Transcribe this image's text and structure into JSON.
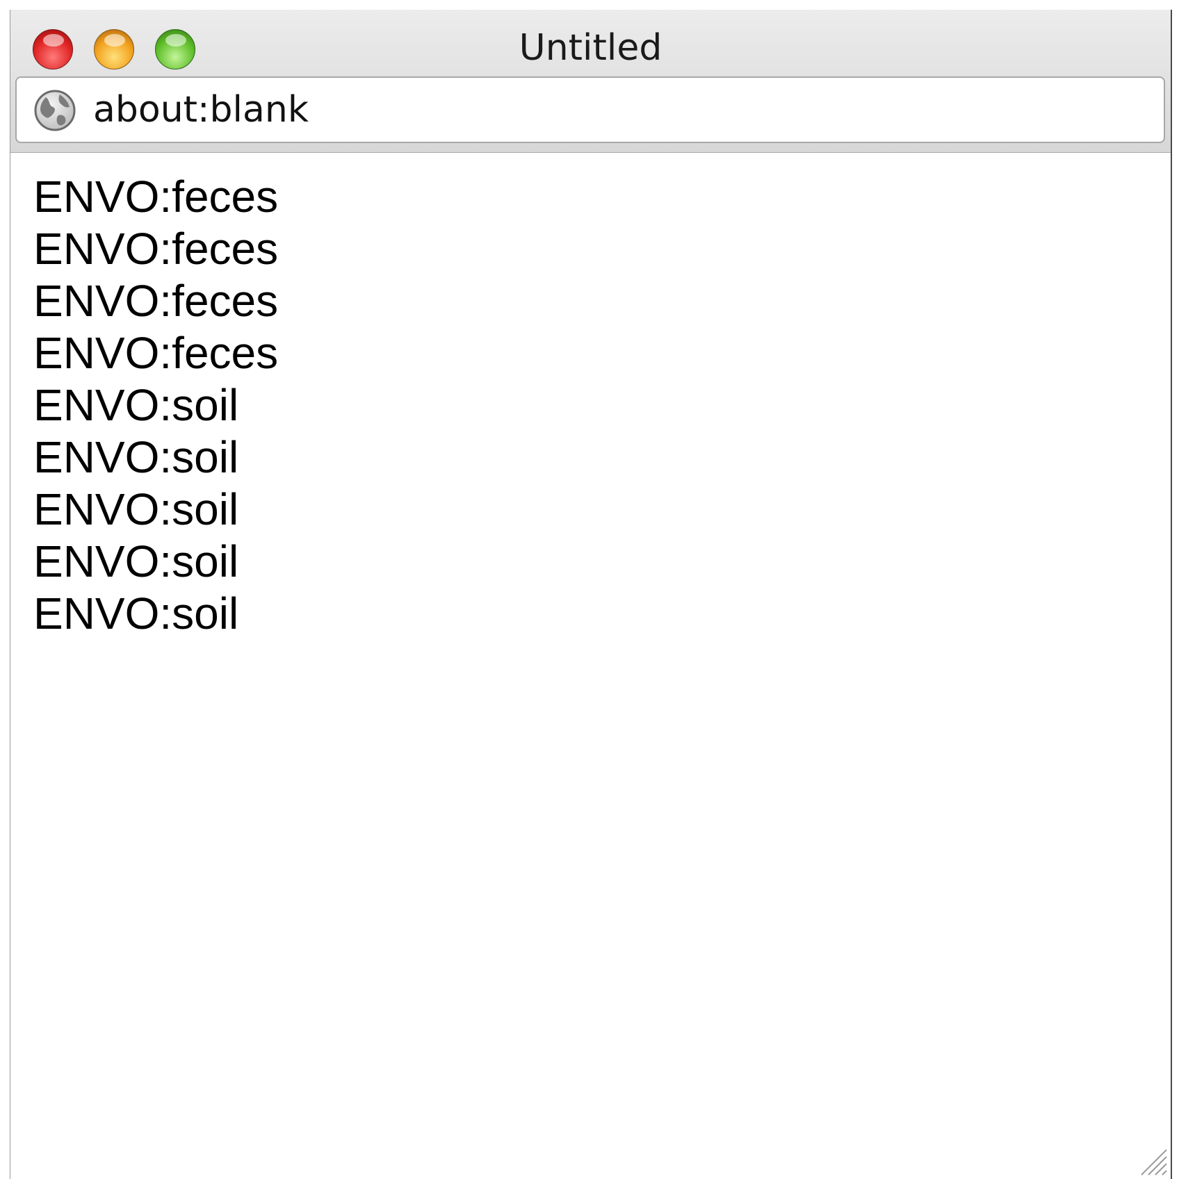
{
  "window": {
    "title": "Untitled",
    "controls": {
      "close_icon": "close-traffic-light",
      "minimize_icon": "minimize-traffic-light",
      "zoom_icon": "zoom-traffic-light"
    }
  },
  "address_bar": {
    "icon": "globe-icon",
    "url": "about:blank"
  },
  "content": {
    "lines": [
      "ENVO:feces",
      "ENVO:feces",
      "ENVO:feces",
      "ENVO:feces",
      "ENVO:soil",
      "ENVO:soil",
      "ENVO:soil",
      "ENVO:soil",
      "ENVO:soil"
    ]
  },
  "colors": {
    "close": "#e02525",
    "minimize": "#f2a21e",
    "zoom": "#5fbf2a",
    "chrome": "#dcdcdc",
    "text": "#000000"
  }
}
